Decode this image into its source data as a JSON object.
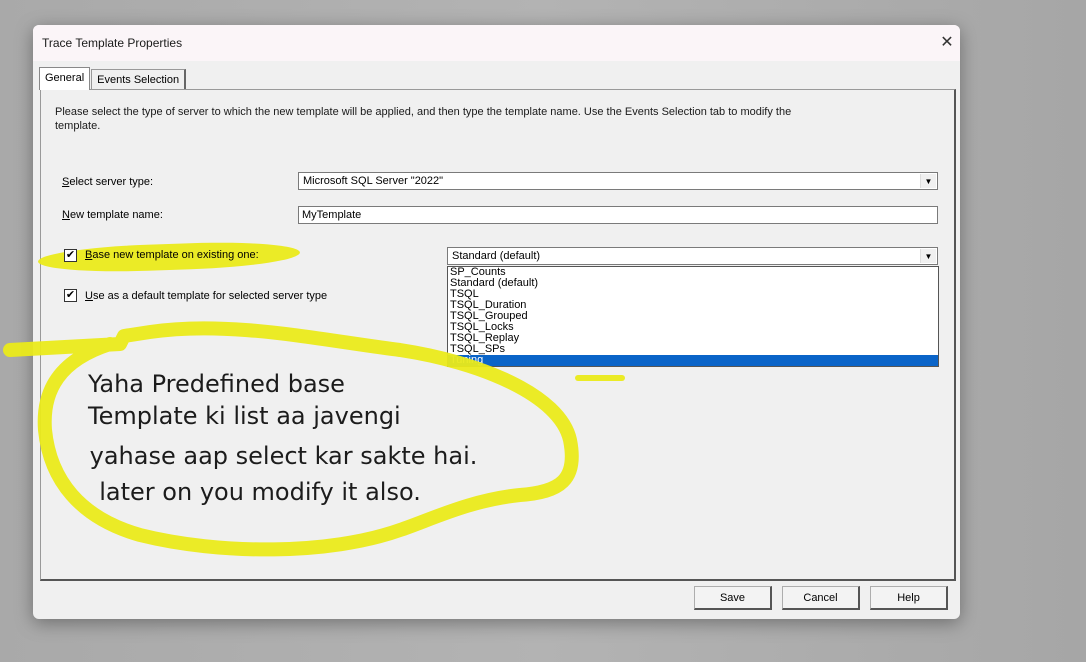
{
  "window": {
    "title": "Trace Template Properties",
    "close_glyph": "✕"
  },
  "tabs": [
    {
      "label": "General",
      "active": true
    },
    {
      "label": "Events Selection",
      "active": false
    }
  ],
  "general": {
    "description": "Please select the type of server to which the new template will be applied, and then type the template name.  Use the Events Selection tab to modify the template.",
    "server_type_label_prefix": "S",
    "server_type_label_rest": "elect server type:",
    "server_type_value": "Microsoft SQL Server \"2022\"",
    "template_name_label_prefix": "N",
    "template_name_label_rest": "ew template name:",
    "template_name_value": "MyTemplate",
    "base_template_check": "☑",
    "base_template_label_prefix": "B",
    "base_template_label_rest": "ase new template on existing one:",
    "base_template_value": "Standard (default)",
    "default_template_label_prefix": "U",
    "default_template_label_rest": "se as a default template for selected server type",
    "dropdown_arrow": "▼",
    "check_mark": "✔"
  },
  "base_template_options": [
    {
      "label": "SP_Counts",
      "selected": false
    },
    {
      "label": "Standard (default)",
      "selected": false
    },
    {
      "label": "TSQL",
      "selected": false
    },
    {
      "label": "TSQL_Duration",
      "selected": false
    },
    {
      "label": "TSQL_Grouped",
      "selected": false
    },
    {
      "label": "TSQL_Locks",
      "selected": false
    },
    {
      "label": "TSQL_Replay",
      "selected": false
    },
    {
      "label": "TSQL_SPs",
      "selected": false
    },
    {
      "label": "Tuning",
      "selected": true
    }
  ],
  "buttons": {
    "save": "Save",
    "cancel": "Cancel",
    "help": "Help"
  },
  "annotation": {
    "line1": "Yaha Predefined base",
    "line2": "Template ki list aa javengi",
    "line3": " yahase aap select kar sakte hai.",
    "line4": "  later on you modify it also.",
    "highlight_color": "#eaea1a"
  }
}
